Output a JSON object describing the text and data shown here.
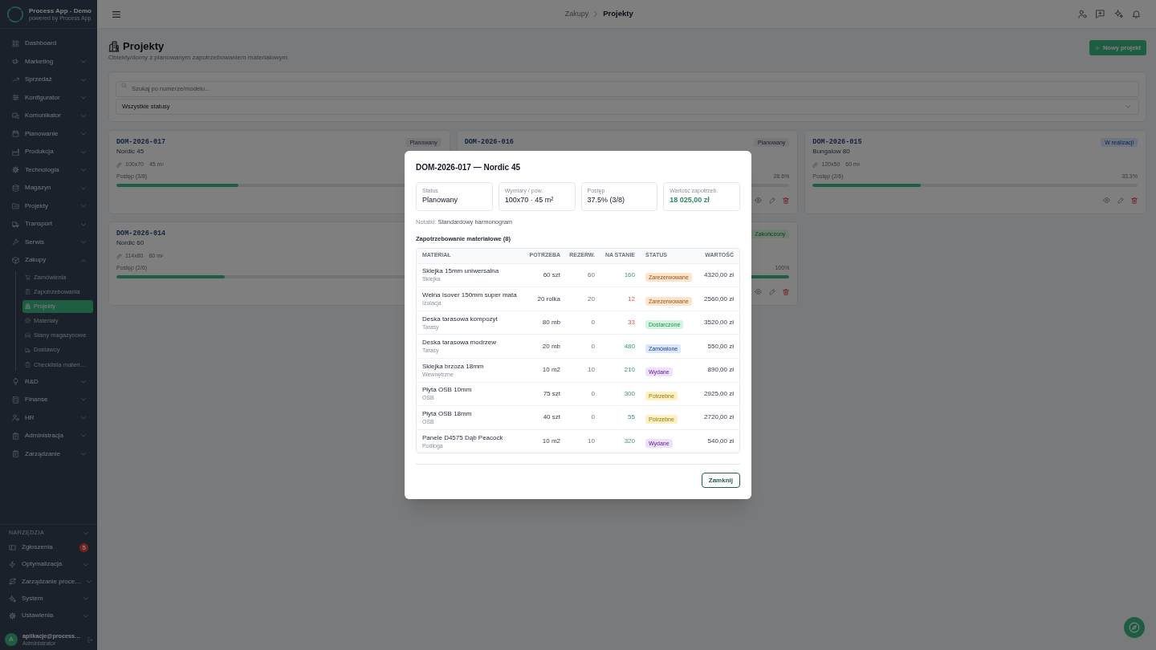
{
  "sidebar": {
    "brand": {
      "title": "Process App - Demo",
      "subtitle": "powered by Process App"
    },
    "items": [
      {
        "label": "Dashboard",
        "kind": "link",
        "selected": false
      },
      {
        "label": "Marketing",
        "kind": "group",
        "expanded": false,
        "selected": false
      },
      {
        "label": "Sprzedaż",
        "kind": "group",
        "expanded": false,
        "selected": false
      },
      {
        "label": "Konfigurator",
        "kind": "group",
        "expanded": false,
        "selected": false
      },
      {
        "label": "Komunikator",
        "kind": "group",
        "expanded": false,
        "selected": false
      },
      {
        "label": "Planowanie",
        "kind": "group",
        "expanded": false,
        "selected": false
      },
      {
        "label": "Produkcja",
        "kind": "group",
        "expanded": false,
        "selected": false
      },
      {
        "label": "Technologia",
        "kind": "group",
        "expanded": false,
        "selected": false
      },
      {
        "label": "Magazyn",
        "kind": "group",
        "expanded": false,
        "selected": false
      },
      {
        "label": "Projekty",
        "kind": "group",
        "expanded": false,
        "selected": false
      },
      {
        "label": "Transport",
        "kind": "group",
        "expanded": false,
        "selected": false
      },
      {
        "label": "Serwis",
        "kind": "group",
        "expanded": false,
        "selected": false
      },
      {
        "label": "Zakupy",
        "kind": "group",
        "expanded": true,
        "selected": false,
        "children": [
          {
            "label": "Zamówienia",
            "selected": false
          },
          {
            "label": "Zapotrzebowania",
            "selected": false
          },
          {
            "label": "Projekty",
            "selected": true
          },
          {
            "label": "Materiały",
            "selected": false
          },
          {
            "label": "Stany magazynowe",
            "selected": false
          },
          {
            "label": "Dostawcy",
            "selected": false
          },
          {
            "label": "Checklista materi…",
            "selected": false
          }
        ]
      },
      {
        "label": "R&D",
        "kind": "group",
        "expanded": false,
        "selected": false
      },
      {
        "label": "Finanse",
        "kind": "group",
        "expanded": false,
        "selected": false
      },
      {
        "label": "HR",
        "kind": "group",
        "expanded": false,
        "selected": false
      },
      {
        "label": "Administracja",
        "kind": "group",
        "expanded": false,
        "selected": false
      },
      {
        "label": "Zarządzanie",
        "kind": "group",
        "expanded": false,
        "selected": false
      }
    ],
    "tools": {
      "title": "NARZĘDZIA",
      "items": [
        {
          "label": "Zgłoszenia",
          "kind": "link",
          "selected": false,
          "badge": "5"
        },
        {
          "label": "Optymalizacja",
          "kind": "group",
          "expanded": false,
          "selected": false
        },
        {
          "label": "Zarządzanie proce…",
          "kind": "group",
          "expanded": false,
          "selected": false
        },
        {
          "label": "System",
          "kind": "group",
          "expanded": false,
          "selected": false
        },
        {
          "label": "Ustawienia",
          "kind": "group",
          "expanded": false,
          "selected": false
        }
      ]
    },
    "user": {
      "initial": "A",
      "name": "aplikacje@process…",
      "role": "Administrator"
    }
  },
  "top_bar": {
    "breadcrumb": [
      {
        "label": "Zakupy",
        "current": false
      },
      {
        "label": "Projekty",
        "current": true
      }
    ]
  },
  "page": {
    "title": "Projekty",
    "subtitle": "Obiekty/domy z planowanym zapotrzebowaniem materiałowym",
    "new_button": "Nowy projekt"
  },
  "filters": {
    "search": {
      "placeholder": "Szukaj po numerze/modelu..."
    },
    "status_select": {
      "value": "Wszystkie statusy"
    }
  },
  "cards": [
    {
      "code": "DOM-2026-017",
      "name": "Nordic 45",
      "status": {
        "label": "Planowany",
        "kind": "planned"
      },
      "dimensions": "100x70",
      "area": "45 m²",
      "progress_label": "Postęp (3/8)",
      "level": 0.375
    },
    {
      "code": "DOM-2026-016",
      "status": {
        "label": "Planowany",
        "kind": "planned"
      },
      "percent": "28.6%",
      "has_actions": true
    },
    {
      "code": "DOM-2026-015",
      "name": "Bungalow 80",
      "status": {
        "label": "W realizacji",
        "kind": "active"
      },
      "dimensions": "120x50",
      "area": "60 m²",
      "progress_label": "Postęp (2/6)",
      "percent": "33.3%",
      "level": 0.333,
      "has_actions": true
    },
    {
      "code": "DOM-2026-014",
      "name": "Nordic 60",
      "dimensions": "114x80",
      "area": "60 m²",
      "progress_label": "Postęp (2/6)",
      "level": 0.333
    },
    {
      "status": {
        "label": "Zakończony",
        "kind": "done"
      },
      "percent": "100%",
      "level": 1,
      "has_actions": true
    }
  ],
  "modal": {
    "title": "DOM-2026-017 — Nordic 45",
    "stats": [
      {
        "label": "Status",
        "value": "Planowany",
        "accent": false
      },
      {
        "label": "Wymiary / pow.",
        "value": "100x70 · 45 m²",
        "accent": false
      },
      {
        "label": "Postęp",
        "value": "37.5% (3/8)",
        "accent": false
      },
      {
        "label": "Wartość zapotrzeb.",
        "value": "18 025,00 zł",
        "accent": true
      }
    ],
    "notes": {
      "label": "Notatki:",
      "text": "Standardowy harmonogram"
    },
    "materials_title": "Zapotrzebowanie materiałowe (8)",
    "table": {
      "columns": [
        "MATERIAŁ",
        "POTRZEBA",
        "REZERW.",
        "NA STANIE",
        "STATUS",
        "WARTOŚĆ"
      ],
      "rows": [
        {
          "name": "Sklejka 15mm uniwersalna",
          "category": "Sklejka",
          "need": "60 szt",
          "reserved": "60",
          "in_stock": "160",
          "sufficient": true,
          "status": {
            "label": "Zarezerwowane",
            "color": "#ffe4cc"
          },
          "value": "4320,00 zł"
        },
        {
          "name": "Wełna Isover 150mm super mata",
          "category": "Izolacja",
          "need": "20 rolka",
          "reserved": "20",
          "in_stock": "12",
          "sufficient": false,
          "status": {
            "label": "Zarezerwowane",
            "color": "#ffe4cc"
          },
          "value": "2560,00 zł"
        },
        {
          "name": "Deska tarasowa kompozyt",
          "category": "Tarasy",
          "need": "80 mb",
          "reserved": "0",
          "in_stock": "33",
          "sufficient": false,
          "status": {
            "label": "Dostarczone",
            "color": "#d3f5e0"
          },
          "value": "3520,00 zł"
        },
        {
          "name": "Deska tarasowa modrzew",
          "category": "Tarasy",
          "need": "20 mb",
          "reserved": "0",
          "in_stock": "480",
          "sufficient": true,
          "status": {
            "label": "Zamówione",
            "color": "#dbe7fd"
          },
          "value": "550,00 zł"
        },
        {
          "name": "Sklejka brzoza 18mm",
          "category": "Wewnętrzne",
          "need": "10 m2",
          "reserved": "10",
          "in_stock": "210",
          "sufficient": true,
          "status": {
            "label": "Wydane",
            "color": "#efe0fc"
          },
          "value": "890,00 zł"
        },
        {
          "name": "Płyta OSB 10mm",
          "category": "OSB",
          "need": "75 szt",
          "reserved": "0",
          "in_stock": "300",
          "sufficient": true,
          "status": {
            "label": "Potrzebne",
            "color": "#fdf0c2"
          },
          "value": "2925,00 zł"
        },
        {
          "name": "Płyta OSB 18mm",
          "category": "OSB",
          "need": "40 szt",
          "reserved": "0",
          "in_stock": "55",
          "sufficient": true,
          "status": {
            "label": "Potrzebne",
            "color": "#fdf0c2"
          },
          "value": "2720,00 zł"
        },
        {
          "name": "Panele D4575 Dąb Peacock",
          "category": "Podłoga",
          "need": "10 m2",
          "reserved": "10",
          "in_stock": "320",
          "sufficient": true,
          "status": {
            "label": "Wydane",
            "color": "#efe0fc"
          },
          "value": "540,00 zł"
        }
      ]
    },
    "close_button": "Zamknij"
  }
}
